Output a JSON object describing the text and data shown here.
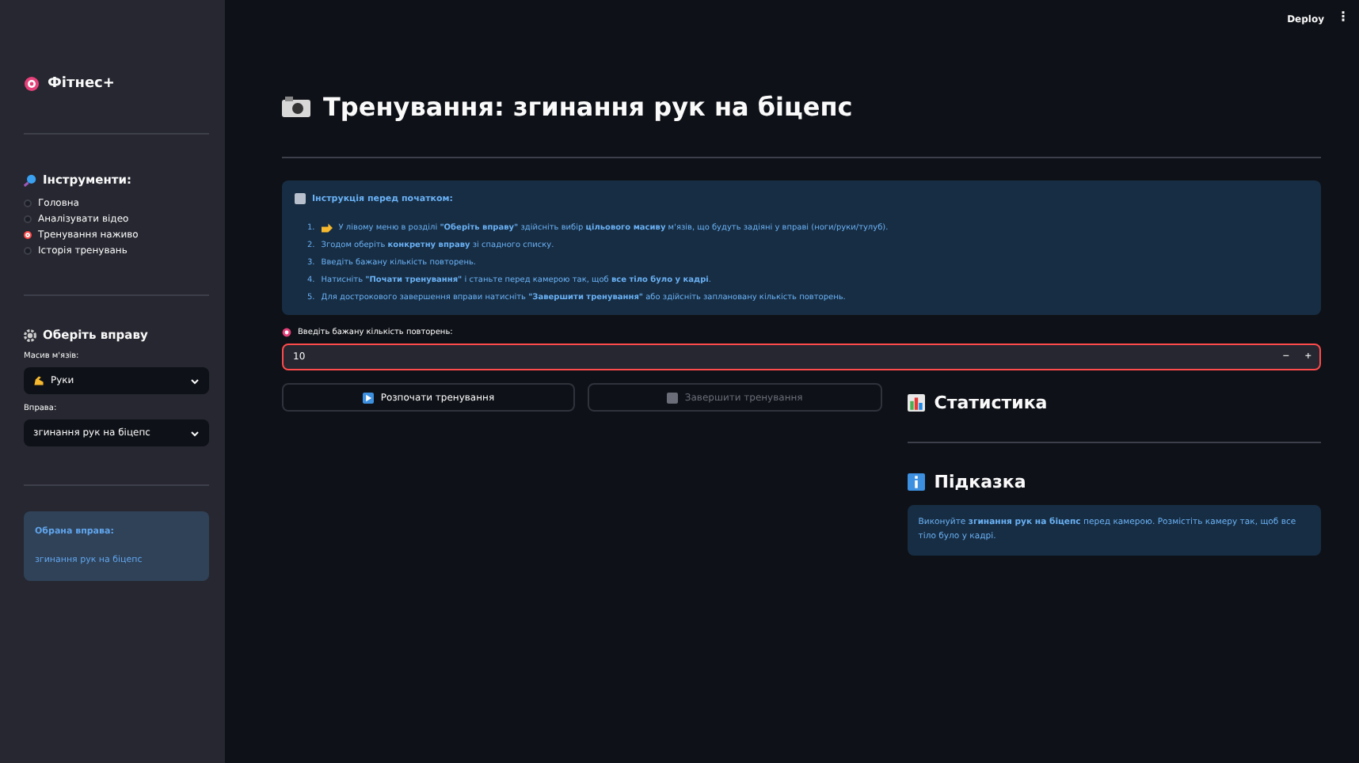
{
  "header": {
    "deploy": "Deploy",
    "menu": "⋮"
  },
  "sidebar": {
    "app_title": "Фітнес+",
    "tools_title": "Інструменти:",
    "nav": [
      {
        "label": "Головна",
        "selected": false
      },
      {
        "label": "Аналізувати відео",
        "selected": false
      },
      {
        "label": "Тренування наживо",
        "selected": true
      },
      {
        "label": "Історія тренувань",
        "selected": false
      }
    ],
    "exercise_title": "Оберіть вправу",
    "muscle_label": "Масив м'язів:",
    "muscle_value": "Руки",
    "exercise_label": "Вправа:",
    "exercise_value": "згинання рук на біцепс",
    "chosen_title": "Обрана вправа:",
    "chosen_value": "згинання рук на біцепс"
  },
  "main": {
    "title": "Тренування: згинання рук на біцепс",
    "instructions_title": "Інструкція перед початком:",
    "instructions": [
      {
        "num": "1.",
        "text": "У лівому меню в розділі **\"Оберіть вправу\"** здійсніть вибір **цільового масиву** м'язів, що будуть задіяні у вправі (ноги/руки/тулуб)."
      },
      {
        "num": "2.",
        "text": "Згодом оберіть **конкретну вправу** зі спадного списку."
      },
      {
        "num": "3.",
        "text": "Введіть бажану кількість повторень."
      },
      {
        "num": "4.",
        "text": "Натисніть **\"Почати тренування\"** і станьте перед камерою так, щоб **все тіло було у кадрі**."
      },
      {
        "num": "5.",
        "text": "Для дострокового завершення вправи натисніть **\"Завершити тренування\"** або здійсніть заплановану кількість повторень."
      }
    ],
    "reps_label": "Введіть бажану кількість повторень:",
    "reps_value": "10",
    "minus": "−",
    "plus": "+",
    "buttons": [
      {
        "label": "Розпочати тренування",
        "disabled": false
      },
      {
        "label": "Завершити тренування",
        "disabled": true
      }
    ],
    "stats_title": "Статистика",
    "hint_title": "Підказка",
    "hint_text": "Виконуйте **згинання рук на біцепс** перед камерою. Розмістіть камеру так, щоб все тіло було у кадрі."
  }
}
